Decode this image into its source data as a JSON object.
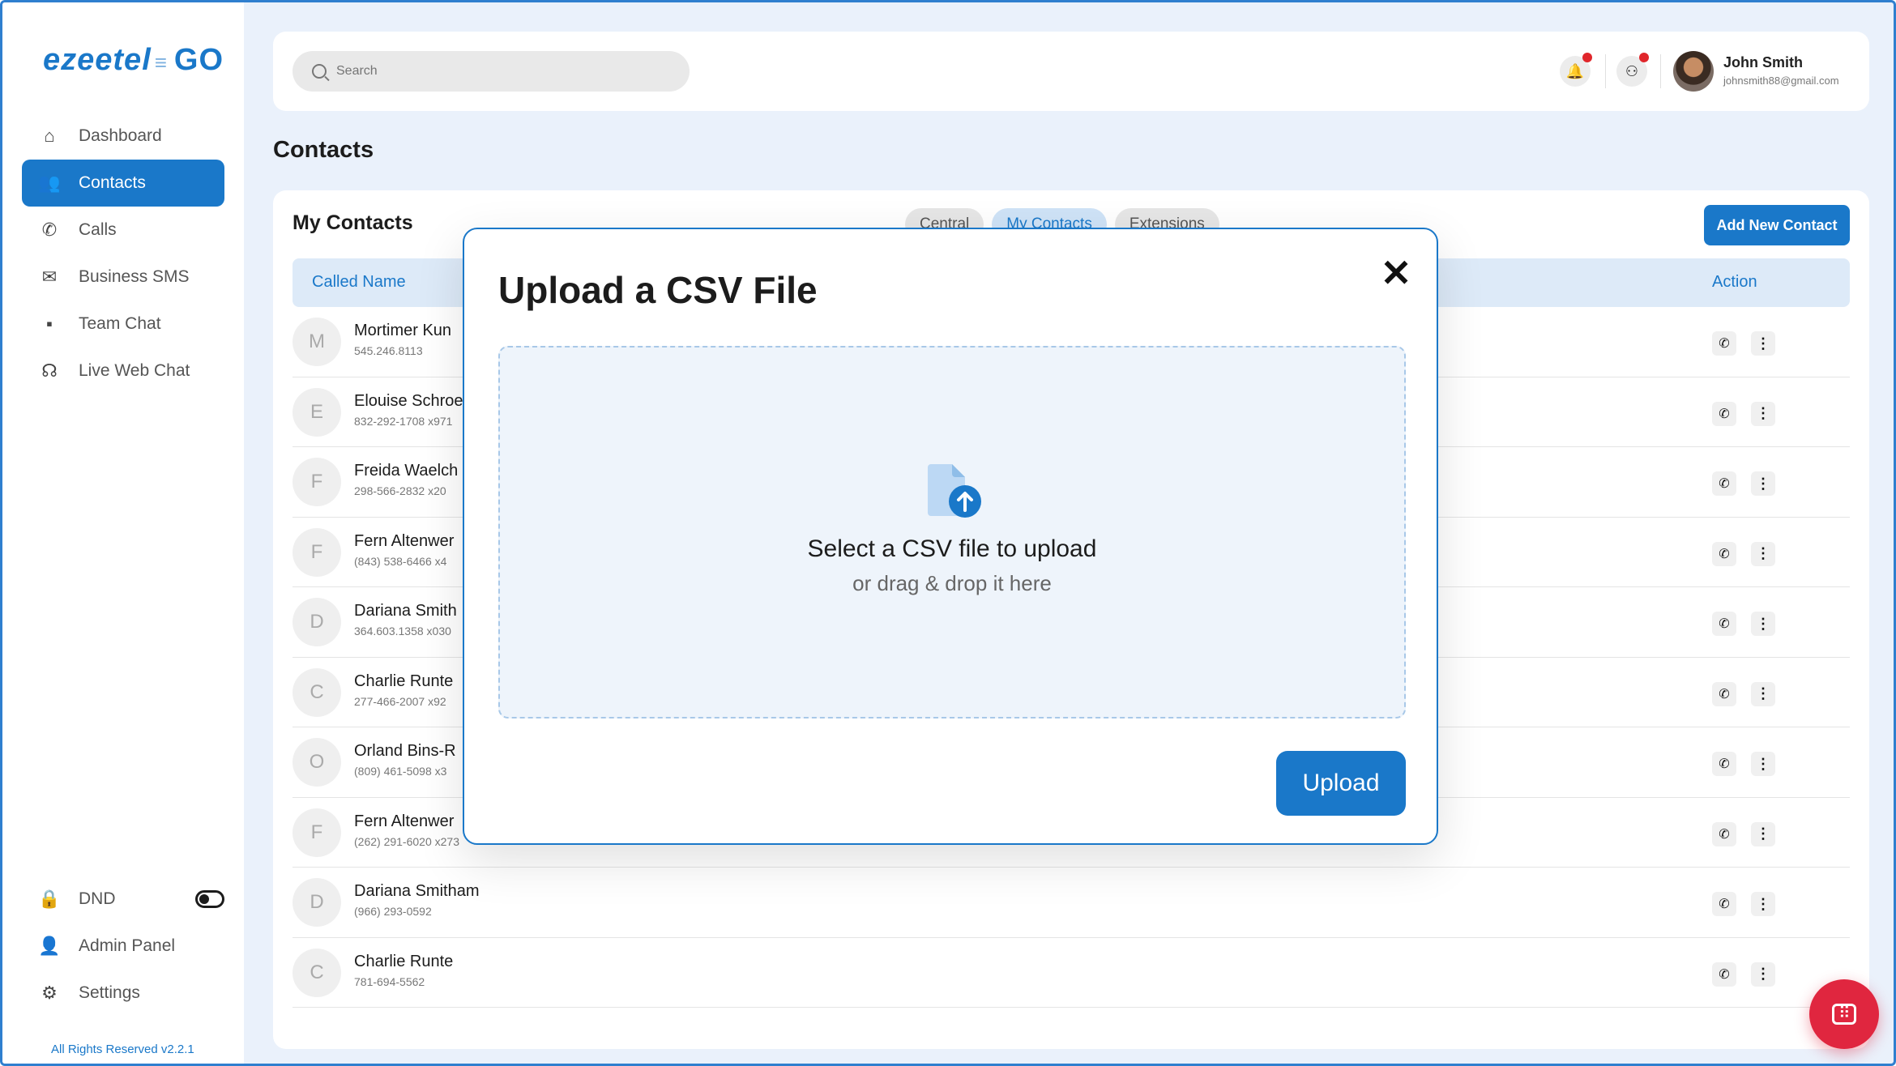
{
  "app": {
    "brand_left": "ezeetel",
    "brand_right": "GO",
    "copyright": "All Rights Reserved v2.2.1"
  },
  "sidebar": {
    "items": [
      {
        "label": "Dashboard",
        "icon": "home-icon"
      },
      {
        "label": "Contacts",
        "icon": "contacts-icon"
      },
      {
        "label": "Calls",
        "icon": "phone-icon"
      },
      {
        "label": "Business SMS",
        "icon": "mail-icon"
      },
      {
        "label": "Team Chat",
        "icon": "chat-icon"
      },
      {
        "label": "Live Web Chat",
        "icon": "headset-icon"
      }
    ],
    "bottom": [
      {
        "label": "DND",
        "icon": "lock-icon"
      },
      {
        "label": "Admin Panel",
        "icon": "admin-icon"
      },
      {
        "label": "Settings",
        "icon": "gear-icon"
      }
    ]
  },
  "topbar": {
    "search_placeholder": "Search",
    "user_name": "John Smith",
    "user_email": "johnsmith88@gmail.com"
  },
  "page": {
    "title": "Contacts"
  },
  "card": {
    "title": "My Contacts",
    "tabs": [
      "Central",
      "My Contacts",
      "Extensions"
    ],
    "add_button": "Add New Contact",
    "col_name": "Called Name",
    "col_action": "Action"
  },
  "contacts": [
    {
      "initial": "M",
      "name": "Mortimer Kun",
      "phone": "545.246.8113"
    },
    {
      "initial": "E",
      "name": "Elouise Schroe",
      "phone": "832-292-1708 x971"
    },
    {
      "initial": "F",
      "name": "Freida Waelch",
      "phone": "298-566-2832 x20"
    },
    {
      "initial": "F",
      "name": "Fern Altenwer",
      "phone": "(843) 538-6466 x4"
    },
    {
      "initial": "D",
      "name": "Dariana Smith",
      "phone": "364.603.1358 x030"
    },
    {
      "initial": "C",
      "name": "Charlie Runte",
      "phone": "277-466-2007 x92"
    },
    {
      "initial": "O",
      "name": "Orland Bins-R",
      "phone": "(809) 461-5098 x3"
    },
    {
      "initial": "F",
      "name": "Fern Altenwer",
      "phone": "(262) 291-6020 x273"
    },
    {
      "initial": "D",
      "name": "Dariana Smitham",
      "phone": "(966) 293-0592"
    },
    {
      "initial": "C",
      "name": "Charlie Runte",
      "phone": "781-694-5562"
    }
  ],
  "modal": {
    "title": "Upload a CSV File",
    "close": "✕",
    "dz_title": "Select a CSV file to upload",
    "dz_sub": "or drag & drop it here",
    "upload": "Upload"
  }
}
